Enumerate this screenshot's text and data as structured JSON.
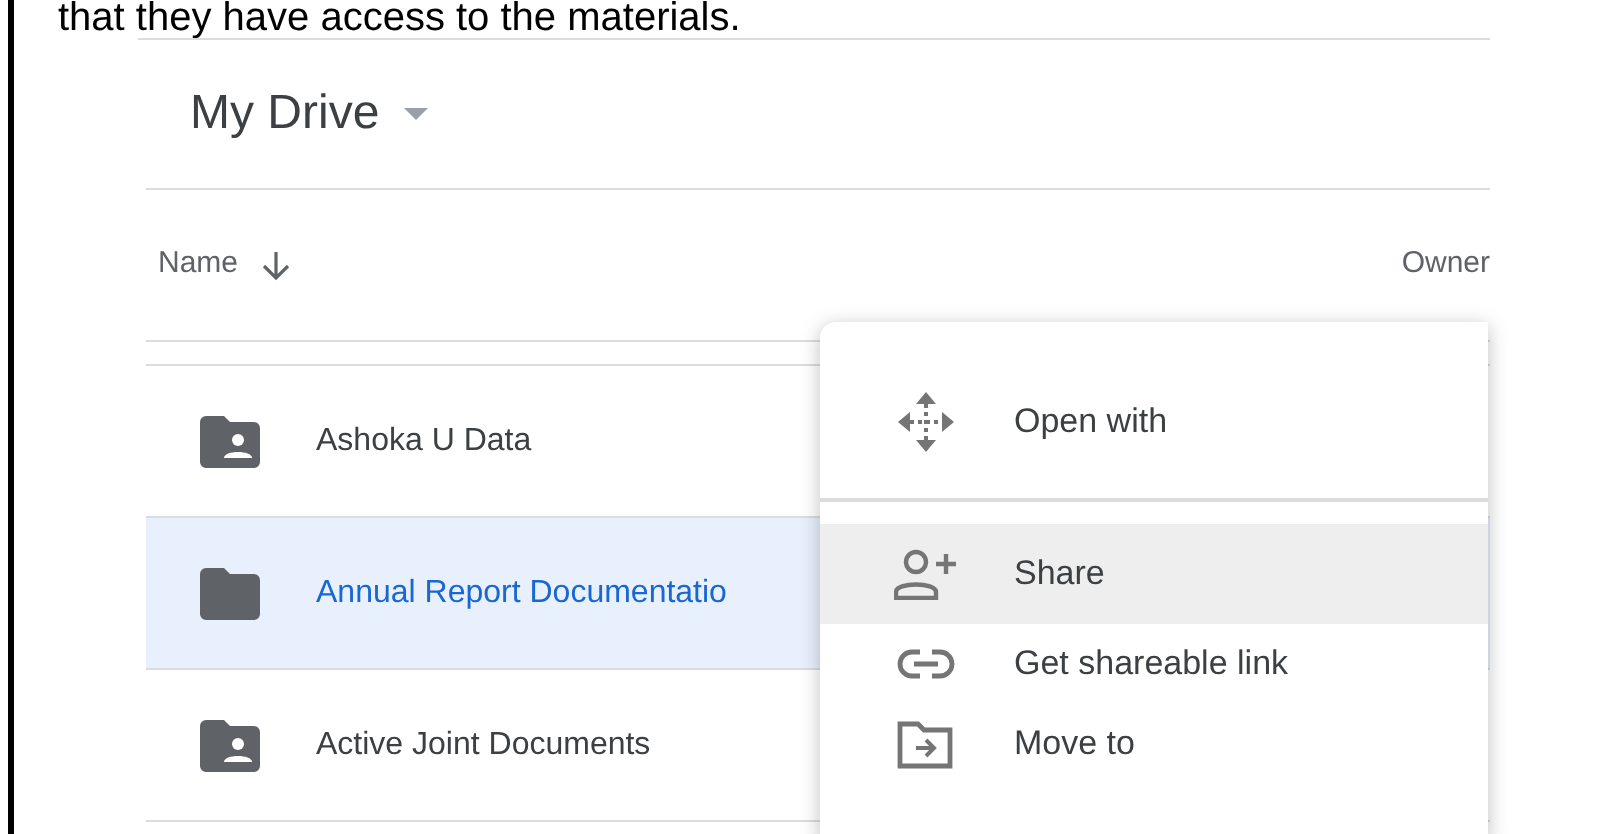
{
  "caption": "that they have access to the materials.",
  "drive": {
    "title": "My Drive",
    "columns": [
      {
        "label": "Name",
        "sorted": true
      },
      {
        "label": "Owner"
      }
    ],
    "rows": [
      {
        "name": "Ashoka U Data",
        "kind": "shared",
        "selected": false
      },
      {
        "name": "Annual Report Documentatio",
        "kind": "folder",
        "selected": true
      },
      {
        "name": "Active Joint Documents",
        "kind": "shared",
        "selected": false
      }
    ]
  },
  "context_menu": {
    "items": [
      {
        "label": "Open with",
        "kind": "open",
        "selected": false,
        "divider_after": true
      },
      {
        "label": "Share",
        "kind": "share",
        "selected": true,
        "divider_after": false
      },
      {
        "label": "Get shareable link",
        "kind": "link",
        "selected": false,
        "divider_after": false
      },
      {
        "label": "Move to",
        "kind": "move",
        "selected": false,
        "divider_after": false
      }
    ]
  }
}
